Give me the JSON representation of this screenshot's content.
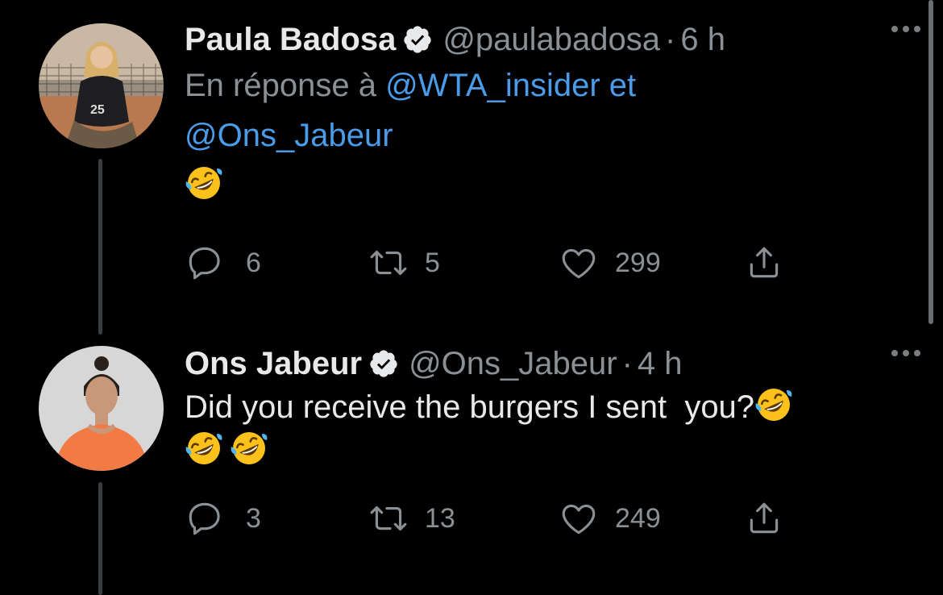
{
  "tweets": [
    {
      "author_name": "Paula Badosa",
      "handle": "@paulabadosa",
      "separator": "·",
      "time": "6 h",
      "reply_prefix": "En réponse à",
      "reply_mention_1": "@WTA_insider",
      "reply_joiner": "et",
      "reply_mention_2": "@Ons_Jabeur",
      "emoji": "rolling-on-the-floor-laughing",
      "counts": {
        "replies": "6",
        "retweets": "5",
        "likes": "299"
      }
    },
    {
      "author_name": "Ons Jabeur",
      "handle": "@Ons_Jabeur",
      "separator": "·",
      "time": "4 h",
      "text": "Did you receive the burgers I sent  you?",
      "emoji": "rolling-on-the-floor-laughing",
      "counts": {
        "replies": "3",
        "retweets": "13",
        "likes": "249"
      }
    }
  ],
  "colors": {
    "background": "#000000",
    "primary_text": "#e7e9ea",
    "secondary_text": "#8b9095",
    "link": "#4a9be8"
  }
}
